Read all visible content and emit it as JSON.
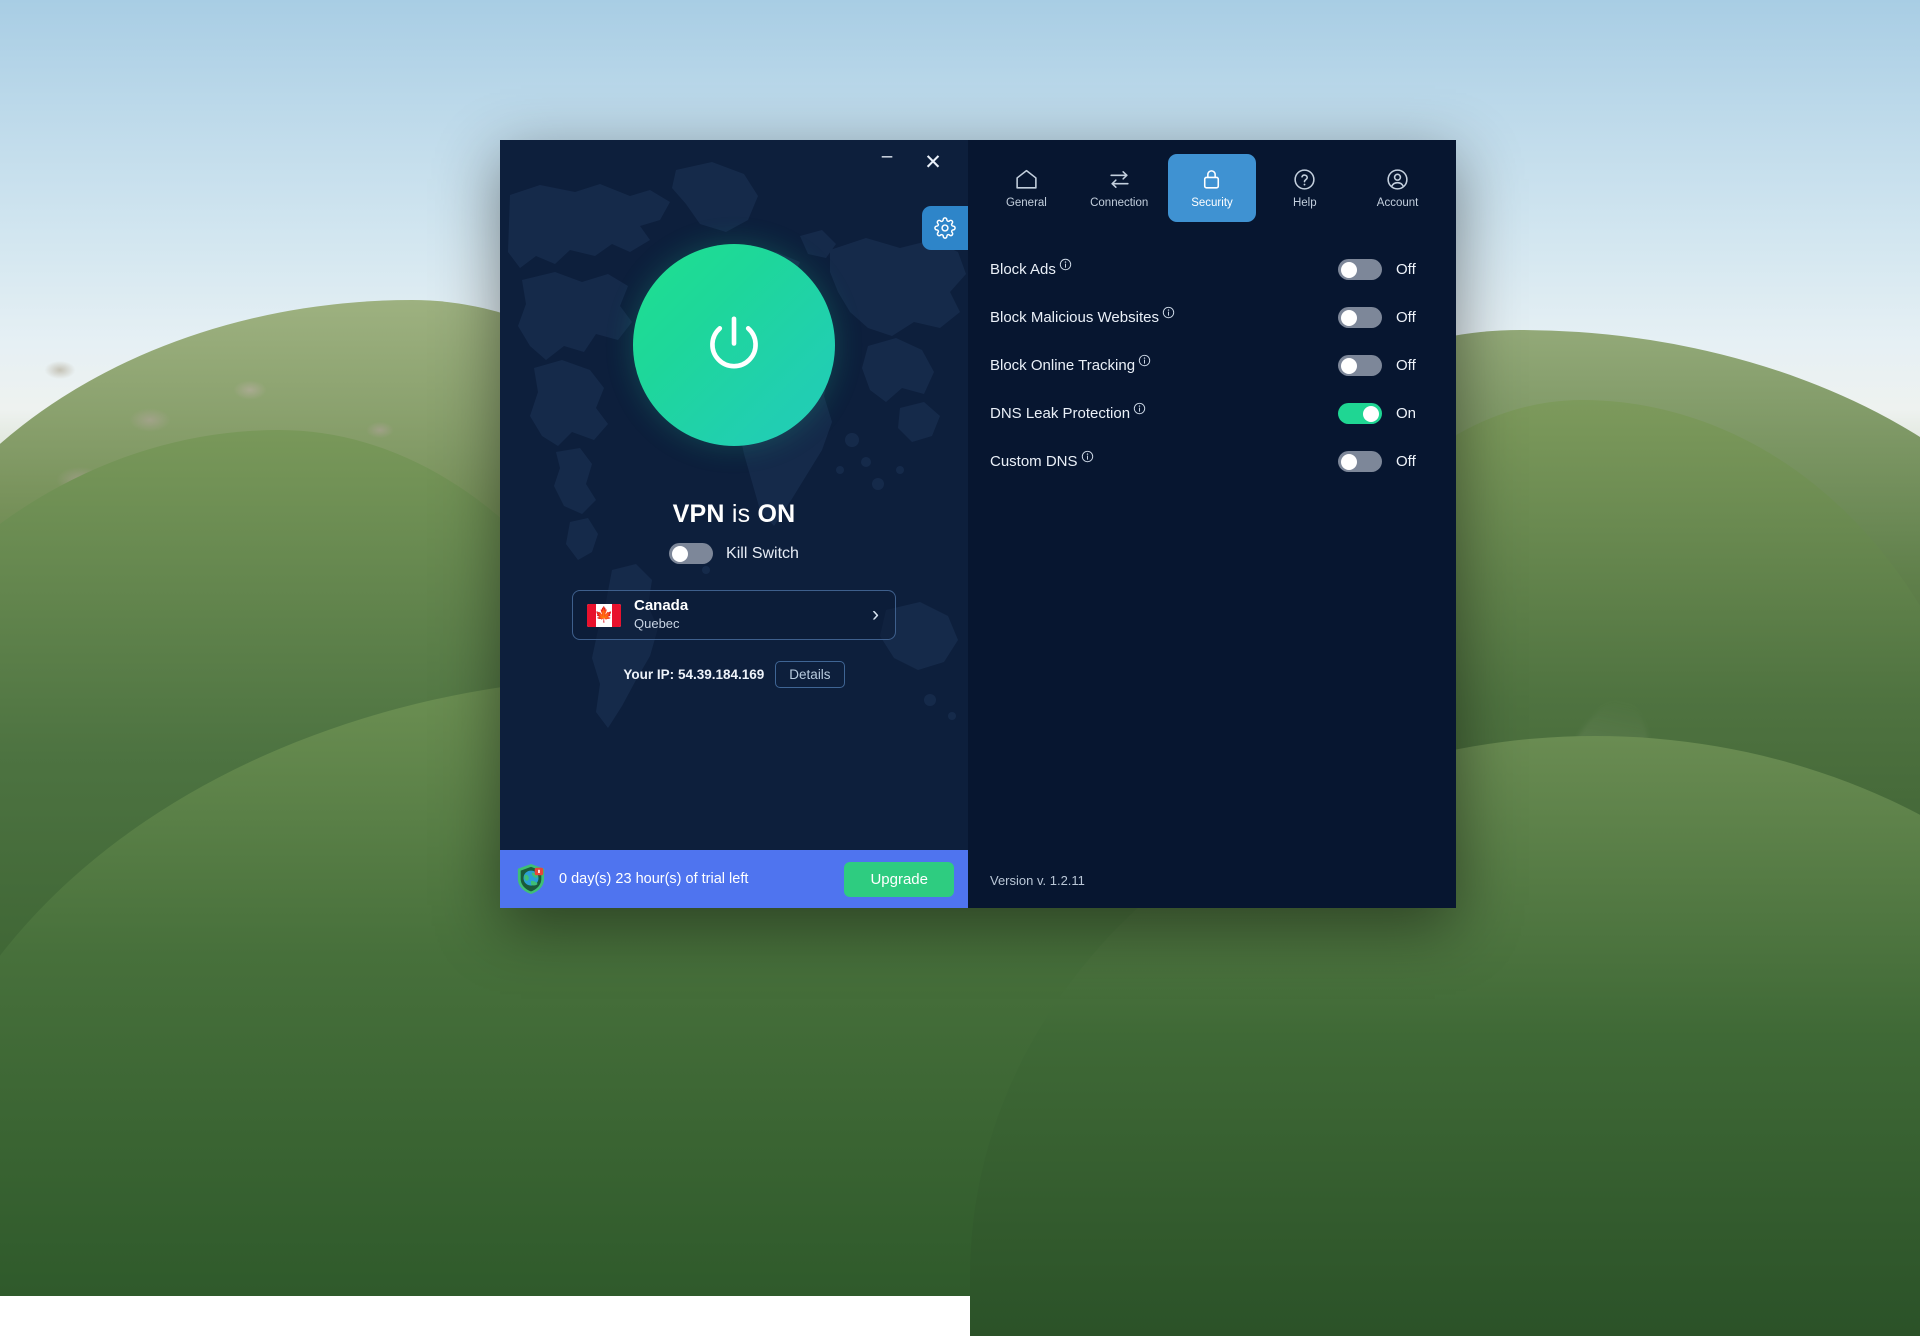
{
  "window": {
    "controls": {
      "minimize": "–",
      "close": "✕",
      "minimize_icon": "minimize-icon",
      "close_icon": "close-icon"
    },
    "settings_gear_icon": "gear-icon"
  },
  "connection": {
    "power_button_icon": "power-icon",
    "status_prefix": "VPN",
    "status_middle": "is",
    "status_suffix": "ON",
    "kill_switch": {
      "label": "Kill Switch",
      "state": "off"
    },
    "server": {
      "country": "Canada",
      "city": "Quebec",
      "flag_icon": "canada-flag-icon",
      "chevron_icon": "chevron-right-icon",
      "chevron": "›"
    },
    "ip": {
      "label": "Your IP:",
      "value": "54.39.184.169",
      "details_button": "Details"
    }
  },
  "trial": {
    "shield_icon": "shield-globe-icon",
    "message": "0 day(s) 23 hour(s) of trial left",
    "upgrade_button": "Upgrade"
  },
  "nav": {
    "tabs": [
      {
        "label": "General",
        "icon": "home-icon",
        "active": false
      },
      {
        "label": "Connection",
        "icon": "transfer-arrows-icon",
        "active": false
      },
      {
        "label": "Security",
        "icon": "lock-icon",
        "active": true
      },
      {
        "label": "Help",
        "icon": "question-circle-icon",
        "active": false
      },
      {
        "label": "Account",
        "icon": "user-circle-icon",
        "active": false
      }
    ]
  },
  "security_settings": {
    "rows": [
      {
        "label": "Block Ads",
        "info_icon": "info-icon",
        "state": "Off",
        "on": false
      },
      {
        "label": "Block Malicious Websites",
        "info_icon": "info-icon",
        "state": "Off",
        "on": false
      },
      {
        "label": "Block Online Tracking",
        "info_icon": "info-icon",
        "state": "Off",
        "on": false
      },
      {
        "label": "DNS Leak Protection",
        "info_icon": "info-icon",
        "state": "On",
        "on": true
      },
      {
        "label": "Custom DNS",
        "info_icon": "info-icon",
        "state": "Off",
        "on": false
      }
    ]
  },
  "footer": {
    "version": "Version v. 1.2.11"
  },
  "colors": {
    "left_panel_bg": "#0d1f3c",
    "right_panel_bg": "#071630",
    "accent_blue": "#3f92d2",
    "gear_blue": "#2e85c9",
    "toggle_on_green": "#1fd693",
    "toggle_off_gray": "#7d8799",
    "trial_banner_blue": "#4f74ef",
    "upgrade_green": "#2ecc80",
    "power_green": "#1fe08f"
  }
}
